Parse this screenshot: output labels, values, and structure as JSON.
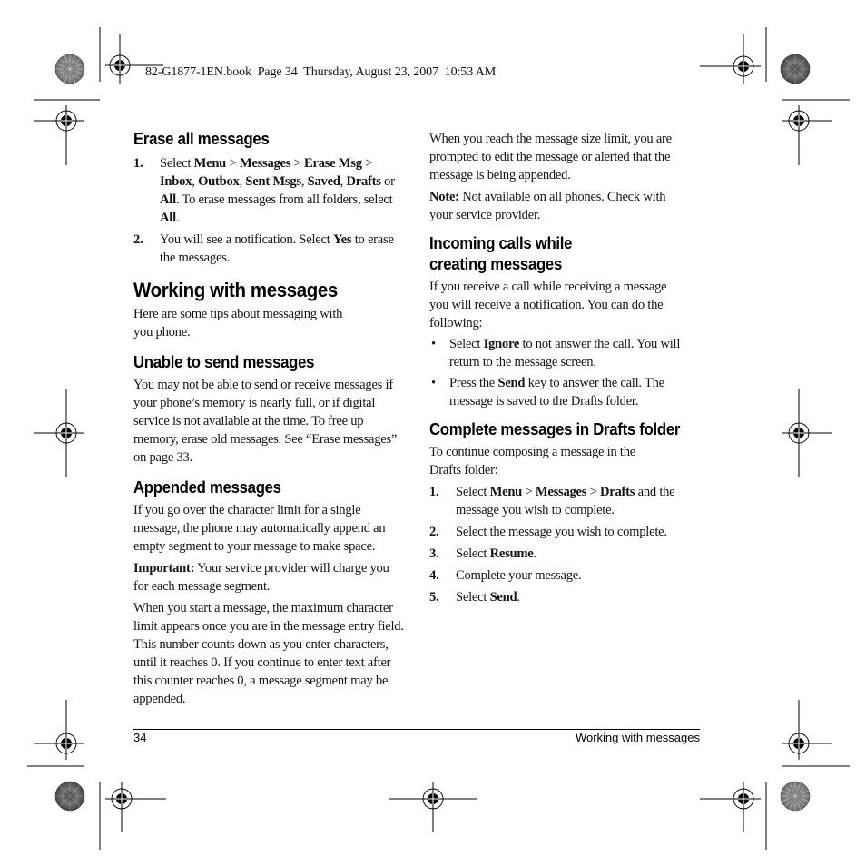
{
  "slug": "82-G1877-1EN.book  Page 34  Thursday, August 23, 2007  10:53 AM",
  "left_column": {
    "erase": {
      "heading": "Erase all messages",
      "steps": [
        {
          "num": "1.",
          "parts": [
            {
              "t": "Select ",
              "b": false
            },
            {
              "t": "Menu",
              "b": true
            },
            {
              "t": " > ",
              "b": false
            },
            {
              "t": "Messages",
              "b": true
            },
            {
              "t": " > ",
              "b": false
            },
            {
              "t": "Erase Msg",
              "b": true
            },
            {
              "t": " > ",
              "b": false
            },
            {
              "t": "Inbox",
              "b": true
            },
            {
              "t": ", ",
              "b": false
            },
            {
              "t": "Outbox",
              "b": true
            },
            {
              "t": ", ",
              "b": false
            },
            {
              "t": "Sent Msgs",
              "b": true
            },
            {
              "t": ", ",
              "b": false
            },
            {
              "t": "Saved",
              "b": true
            },
            {
              "t": ", ",
              "b": false
            },
            {
              "t": "Drafts",
              "b": true
            },
            {
              "t": " or ",
              "b": false
            },
            {
              "t": "All",
              "b": true
            },
            {
              "t": ". To erase messages from all folders, select ",
              "b": false
            },
            {
              "t": "All",
              "b": true
            },
            {
              "t": ".",
              "b": false
            }
          ]
        },
        {
          "num": "2.",
          "parts": [
            {
              "t": "You will see a notification. Select ",
              "b": false
            },
            {
              "t": "Yes",
              "b": true
            },
            {
              "t": " to erase the messages.",
              "b": false
            }
          ]
        }
      ]
    },
    "working": {
      "heading": "Working with messages",
      "intro": "Here are some tips about messaging with you phone."
    },
    "unable": {
      "heading": "Unable to send messages",
      "body": "You may not be able to send or receive messages if your phone’s memory is nearly full, or if digital service is not available at the time. To free up memory, erase old messages. See “Erase messages” on page 33."
    },
    "appended": {
      "heading": "Appended messages",
      "body1": "If you go over the character limit for a single message, the phone may automatically append an empty segment to your message to make space.",
      "important_label": "Important:",
      "important_text": " Your service provider will charge you for each message segment.",
      "body2": "When you start a message, the maximum character limit appears once you are in the message entry field. This number counts down as you enter characters, until it reaches 0. If you continue to enter text after this counter reaches 0, a message segment may be appended."
    }
  },
  "right_column": {
    "size_limit": "When you reach the message size limit, you are prompted to edit the message or alerted that the message is being appended.",
    "note_label": "Note:",
    "note_text": " Not available on all phones. Check with your service provider.",
    "incoming": {
      "heading_line1": "Incoming calls while",
      "heading_line2": "creating messages",
      "intro": "If you receive a call while receiving a message you will receive a notification. You can do the following:",
      "bullets": [
        {
          "num": "•",
          "parts": [
            {
              "t": "Select ",
              "b": false
            },
            {
              "t": "Ignore",
              "b": true
            },
            {
              "t": " to not answer the call. You will return to the message screen.",
              "b": false
            }
          ]
        },
        {
          "num": "•",
          "parts": [
            {
              "t": "Press the ",
              "b": false
            },
            {
              "t": "Send",
              "b": true
            },
            {
              "t": " key to answer the call. The message is saved to the Drafts folder.",
              "b": false
            }
          ]
        }
      ]
    },
    "drafts": {
      "heading": "Complete messages in Drafts folder",
      "intro": "To continue composing a message in the Drafts folder:",
      "steps": [
        {
          "num": "1.",
          "parts": [
            {
              "t": "Select ",
              "b": false
            },
            {
              "t": "Menu",
              "b": true
            },
            {
              "t": " > ",
              "b": false
            },
            {
              "t": "Messages",
              "b": true
            },
            {
              "t": " > ",
              "b": false
            },
            {
              "t": "Drafts",
              "b": true
            },
            {
              "t": " and the message you wish to complete.",
              "b": false
            }
          ]
        },
        {
          "num": "2.",
          "parts": [
            {
              "t": "Select the message you wish to complete.",
              "b": false
            }
          ]
        },
        {
          "num": "3.",
          "parts": [
            {
              "t": "Select ",
              "b": false
            },
            {
              "t": "Resume",
              "b": true
            },
            {
              "t": ".",
              "b": false
            }
          ]
        },
        {
          "num": "4.",
          "parts": [
            {
              "t": "Complete your message.",
              "b": false
            }
          ]
        },
        {
          "num": "5.",
          "parts": [
            {
              "t": "Select ",
              "b": false
            },
            {
              "t": "Send",
              "b": true
            },
            {
              "t": ".",
              "b": false
            }
          ]
        }
      ]
    }
  },
  "footer": {
    "page_number": "34",
    "section_title": "Working with messages"
  }
}
